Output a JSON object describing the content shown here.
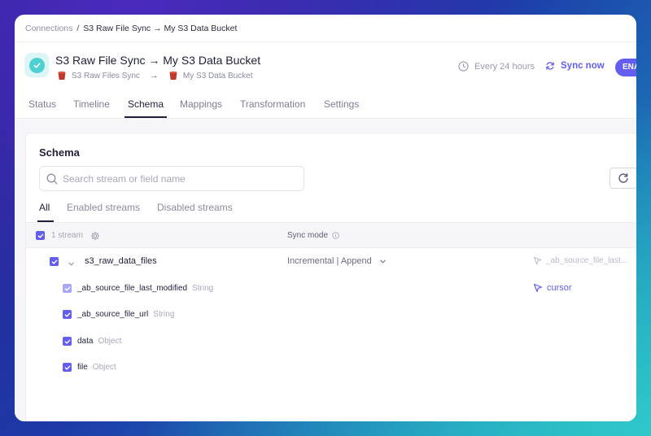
{
  "breadcrumb": {
    "root": "Connections",
    "separator": "/",
    "current": "S3 Raw File Sync → My S3 Data Bucket"
  },
  "header": {
    "title": "S3 Raw File Sync → My S3 Data Bucket",
    "source": "S3 Raw Files Sync",
    "arrow": "→",
    "destination": "My S3 Data Bucket",
    "schedule": "Every 24 hours",
    "sync_now": "Sync now",
    "enable_label": "ENA"
  },
  "tabs": [
    "Status",
    "Timeline",
    "Schema",
    "Mappings",
    "Transformation",
    "Settings"
  ],
  "active_tab": "Schema",
  "schema": {
    "title": "Schema",
    "search_placeholder": "Search stream or field name",
    "subtabs": [
      "All",
      "Enabled streams",
      "Disabled streams"
    ],
    "header": {
      "count": "1 stream",
      "sync_mode": "Sync mode"
    },
    "stream": {
      "name": "s3_raw_data_files",
      "sync_mode": "Incremental | Append",
      "cursor_field": "_ab_source_file_last..."
    },
    "fields": [
      {
        "name": "_ab_source_file_last_modified",
        "type": "String",
        "cursor": "cursor"
      },
      {
        "name": "_ab_source_file_url",
        "type": "String"
      },
      {
        "name": "data",
        "type": "Object"
      },
      {
        "name": "file",
        "type": "Object"
      }
    ]
  },
  "colors": {
    "accent": "#615ef0",
    "success": "#4ecfd2",
    "text": "#1f1f3a",
    "muted": "#8e8fa3"
  }
}
